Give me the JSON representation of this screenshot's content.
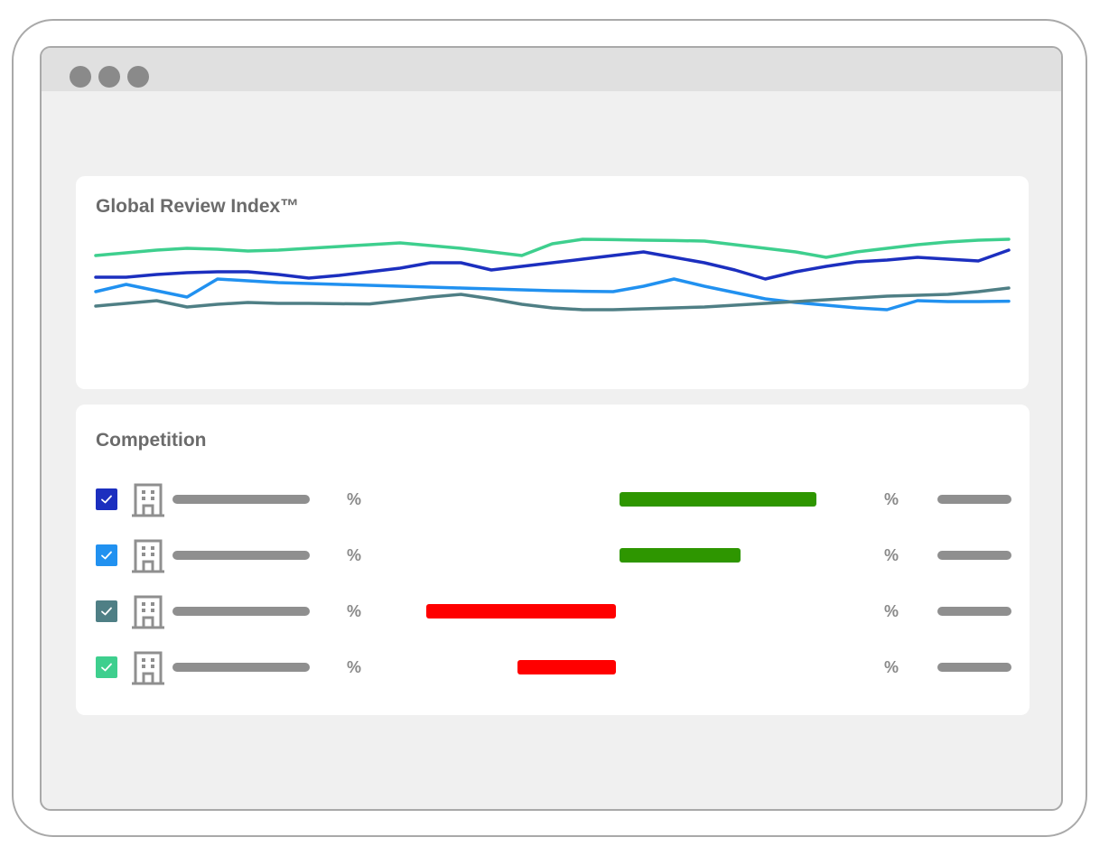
{
  "window": {
    "controls": [
      "dot-1",
      "dot-2",
      "dot-3"
    ]
  },
  "review_index": {
    "title": "Global Review Index™",
    "chart_data": {
      "type": "line",
      "title": "Global Review Index™",
      "xlabel": "",
      "ylabel": "",
      "ylim": [
        0,
        100
      ],
      "grid": false,
      "legend": "none",
      "x": [
        0,
        1,
        2,
        3,
        4,
        5,
        6,
        7,
        8,
        9,
        10,
        11,
        12,
        13,
        14,
        15,
        16,
        17,
        18,
        19,
        20,
        21,
        22,
        23,
        24,
        25,
        26,
        27,
        28,
        29,
        30
      ],
      "series": [
        {
          "color": "#3ecf8e",
          "values": [
            72,
            73.5,
            75,
            76,
            75.5,
            74.5,
            75,
            76,
            77,
            78,
            79,
            77.5,
            76,
            74,
            72,
            78.5,
            81,
            80.8,
            80.5,
            80.3,
            80,
            78,
            76,
            74,
            71,
            74,
            76,
            78,
            79.5,
            80.5,
            81
          ]
        },
        {
          "color": "#1c2fbf",
          "values": [
            60,
            60,
            61.5,
            62.5,
            63,
            63,
            61.5,
            59.5,
            61,
            63,
            65,
            68,
            68,
            64,
            66,
            68,
            70,
            72,
            74,
            71,
            68,
            64,
            59,
            63,
            66,
            68.5,
            69.5,
            71,
            70,
            69,
            75
          ]
        },
        {
          "color": "#2191f0",
          "values": [
            52,
            56,
            52.5,
            49,
            59,
            58,
            57,
            56.5,
            56,
            55.5,
            55,
            54.5,
            54,
            53.5,
            53,
            52.5,
            52.2,
            52,
            55,
            59,
            55,
            51.5,
            48,
            46,
            44.5,
            43,
            42,
            47,
            46.5,
            46.5,
            46.7
          ]
        },
        {
          "color": "#4f7f85",
          "values": [
            44,
            45.5,
            47,
            43.5,
            45,
            46,
            45.5,
            45.5,
            45.3,
            45.2,
            47,
            49,
            50.5,
            48,
            45,
            43,
            42,
            42,
            42.5,
            43,
            43.5,
            44.5,
            45.5,
            46.5,
            47.5,
            48.5,
            49.5,
            50,
            50.5,
            52,
            54
          ]
        }
      ]
    }
  },
  "competition": {
    "title": "Competition",
    "rows": [
      {
        "checkbox_color": "#1c2fbf",
        "percent_left": "%",
        "percent_right": "%",
        "change": 52,
        "bar_color": "#2e9600",
        "icon": "building-icon"
      },
      {
        "checkbox_color": "#2191f0",
        "percent_left": "%",
        "percent_right": "%",
        "change": 32,
        "bar_color": "#2e9600",
        "icon": "building-icon"
      },
      {
        "checkbox_color": "#4f7f85",
        "percent_left": "%",
        "percent_right": "%",
        "change": -50,
        "bar_color": "#ff0000",
        "icon": "building-icon"
      },
      {
        "checkbox_color": "#3ecf8e",
        "percent_left": "%",
        "percent_right": "%",
        "change": -26,
        "bar_color": "#ff0000",
        "icon": "building-icon"
      }
    ]
  }
}
